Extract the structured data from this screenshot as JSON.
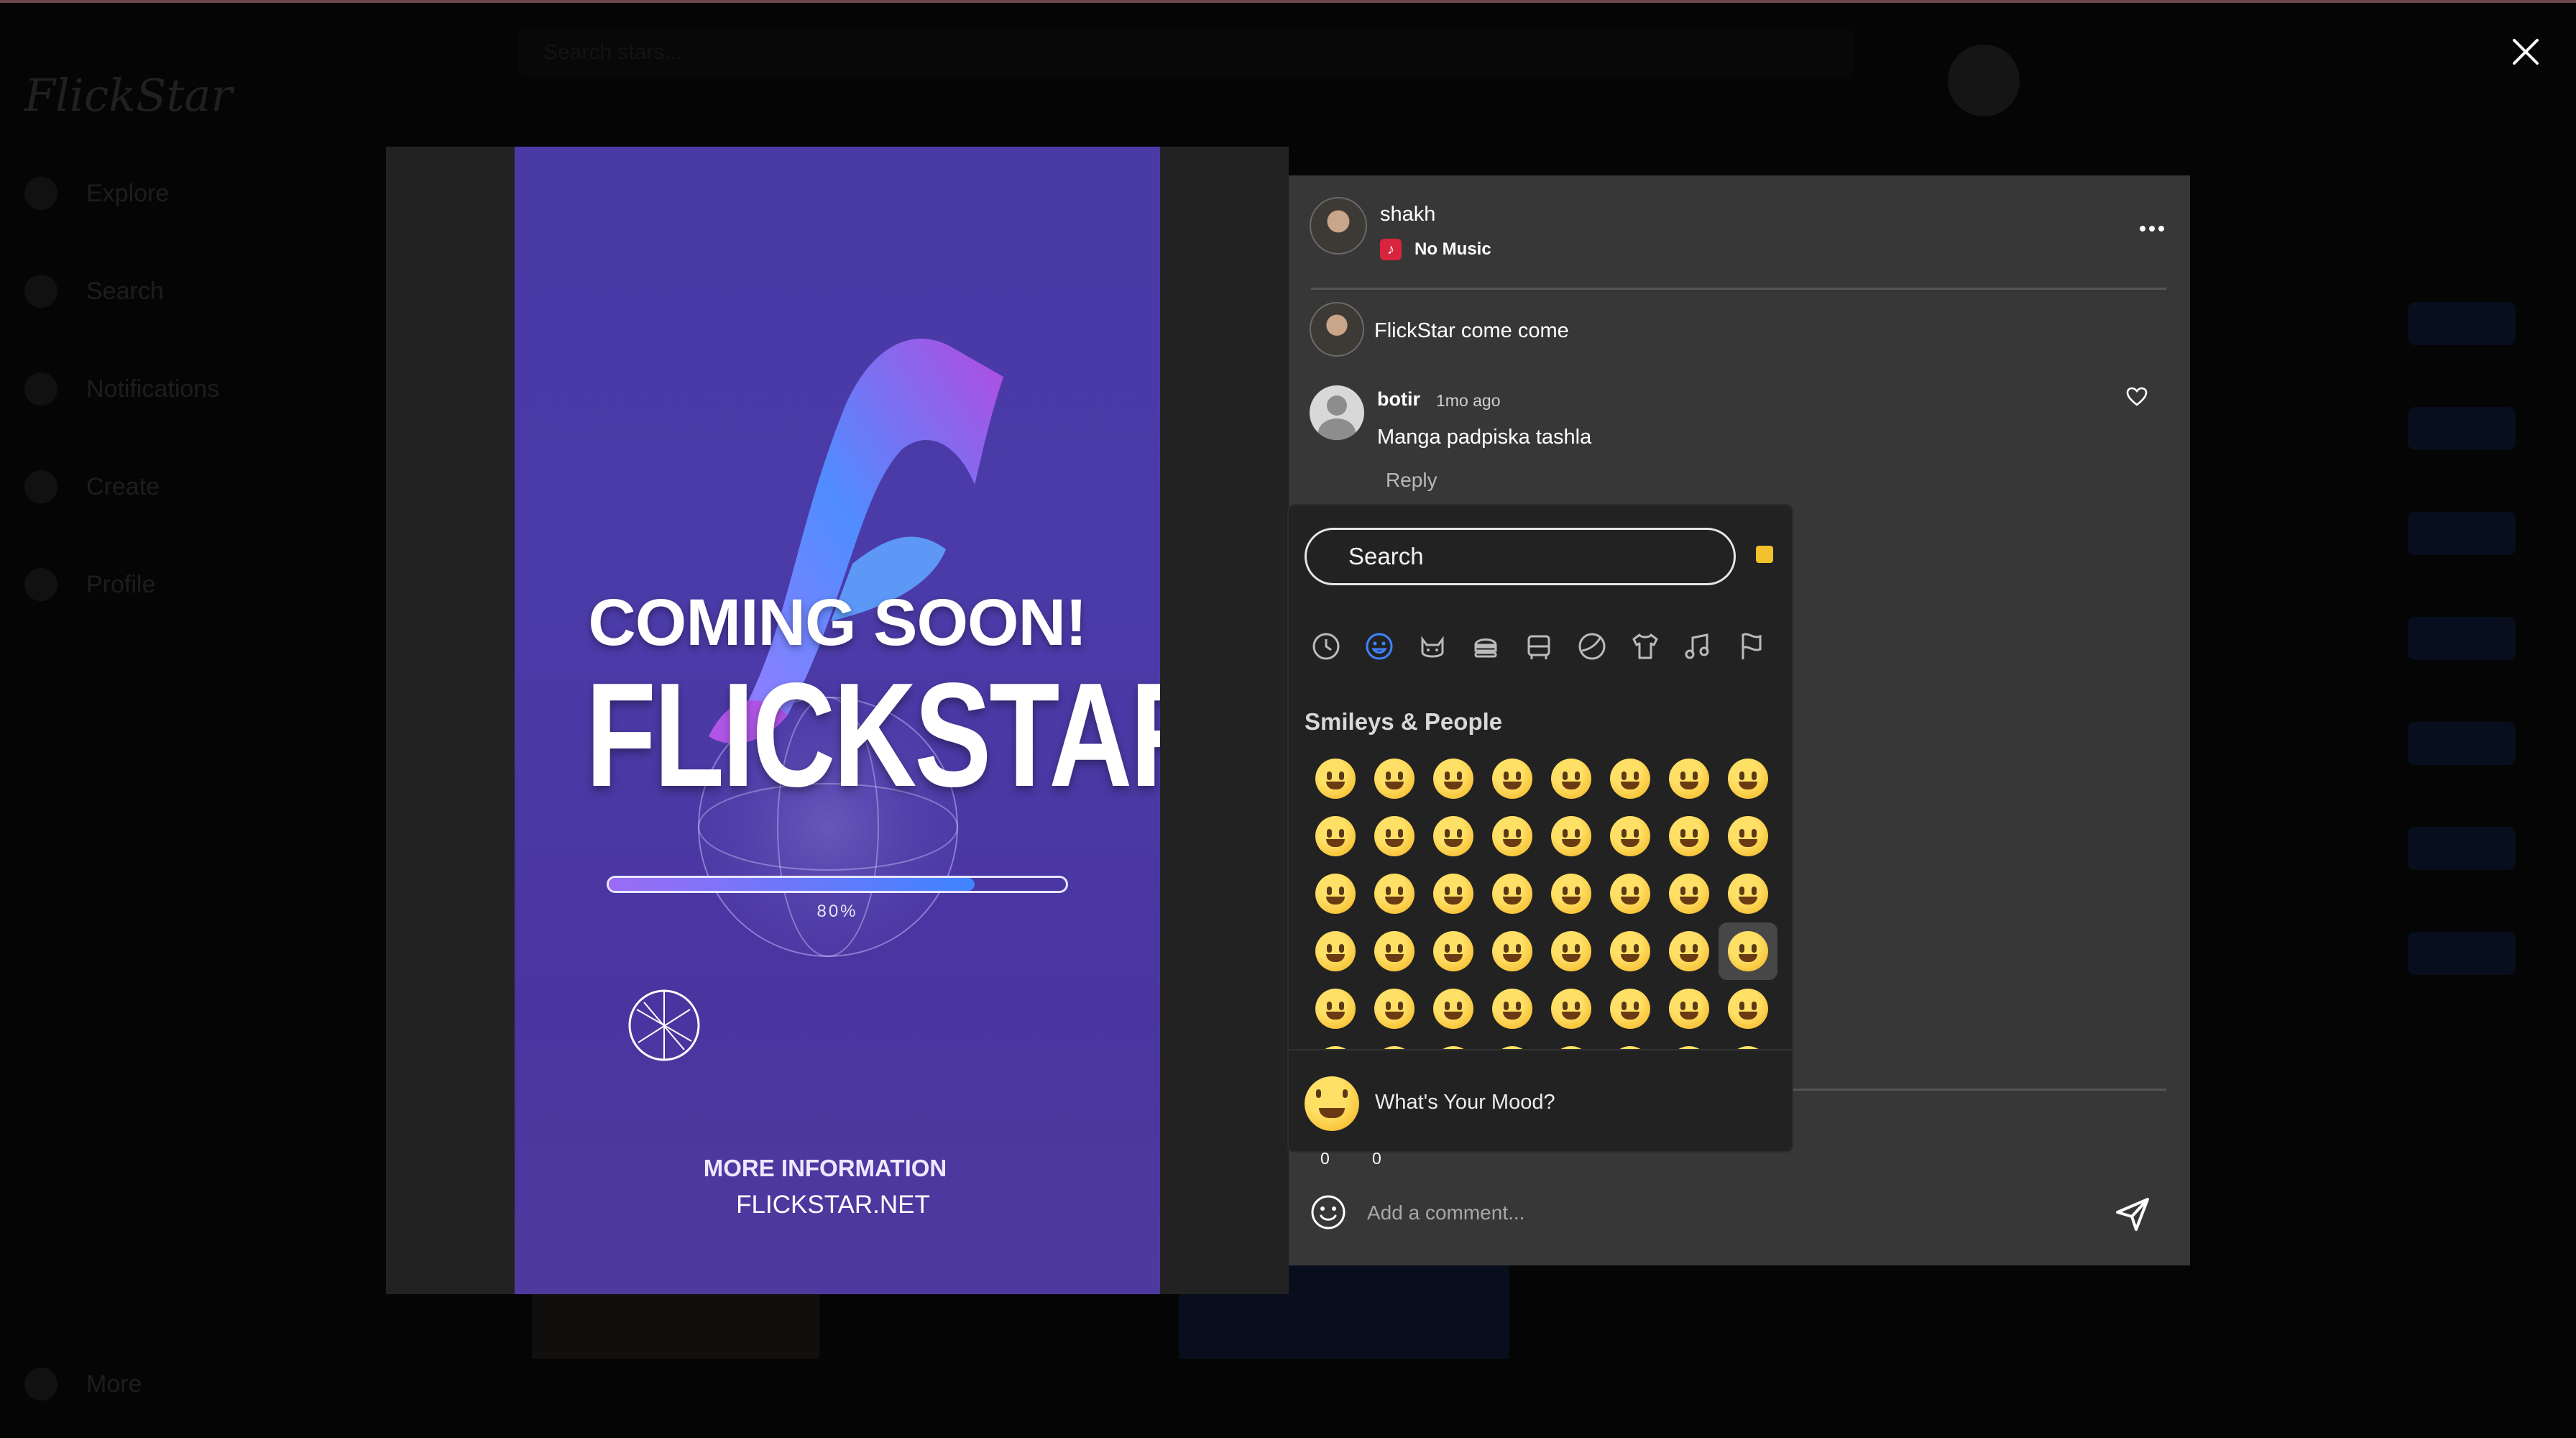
{
  "background_app": {
    "logo": "FlickStar",
    "nav": [
      "Explore",
      "Search",
      "Notifications",
      "Create",
      "Profile"
    ],
    "more": "More",
    "search_placeholder": "Search stars..."
  },
  "post": {
    "author": "shakh",
    "music": "No Music",
    "caption": "FlickStar come come",
    "likes": "0",
    "comments_count": "0"
  },
  "poster": {
    "headline": "COMING SOON!",
    "brand": "FLICKSTAR",
    "progress_percent": 80,
    "progress_label": "80%",
    "more_info": "MORE INFORMATION",
    "site": "FLICKSTAR.NET"
  },
  "comment": {
    "user": "botir",
    "time": "1mo ago",
    "text": "Manga padpiska tashla",
    "reply": "Reply"
  },
  "emoji_picker": {
    "search_placeholder": "Search",
    "categories": [
      "recent-icon",
      "smileys-icon",
      "animals-icon",
      "food-icon",
      "travel-icon",
      "activities-icon",
      "objects-icon",
      "symbols-icon",
      "flags-icon"
    ],
    "active_category": "smileys-icon",
    "section_title": "Smileys & People",
    "emojis": [
      "😀",
      "😃",
      "😄",
      "😁",
      "😆",
      "😅",
      "🤣",
      "😂",
      "🙂",
      "🙃",
      "🫠",
      "😉",
      "😊",
      "😇",
      "🥰",
      "😍",
      "🤩",
      "😘",
      "😗",
      "☺️",
      "😚",
      "😙",
      "🥲",
      "😋",
      "😛",
      "😜",
      "🤪",
      "😝",
      "🤑",
      "🤗",
      "🤭",
      "🫢",
      "🫣",
      "🤫",
      "🤔",
      "🫡",
      "🤐",
      "🤨",
      "😐",
      "😑"
    ],
    "selected_index": 31,
    "mood_label": "What's Your Mood?"
  },
  "composer": {
    "placeholder": "Add a comment..."
  },
  "colors": {
    "panel": "#373737",
    "picker": "#222222",
    "accent_blue": "#3f84ff",
    "poster_purple": "#4a3aa6",
    "skin_tone": "#f2c12e"
  }
}
